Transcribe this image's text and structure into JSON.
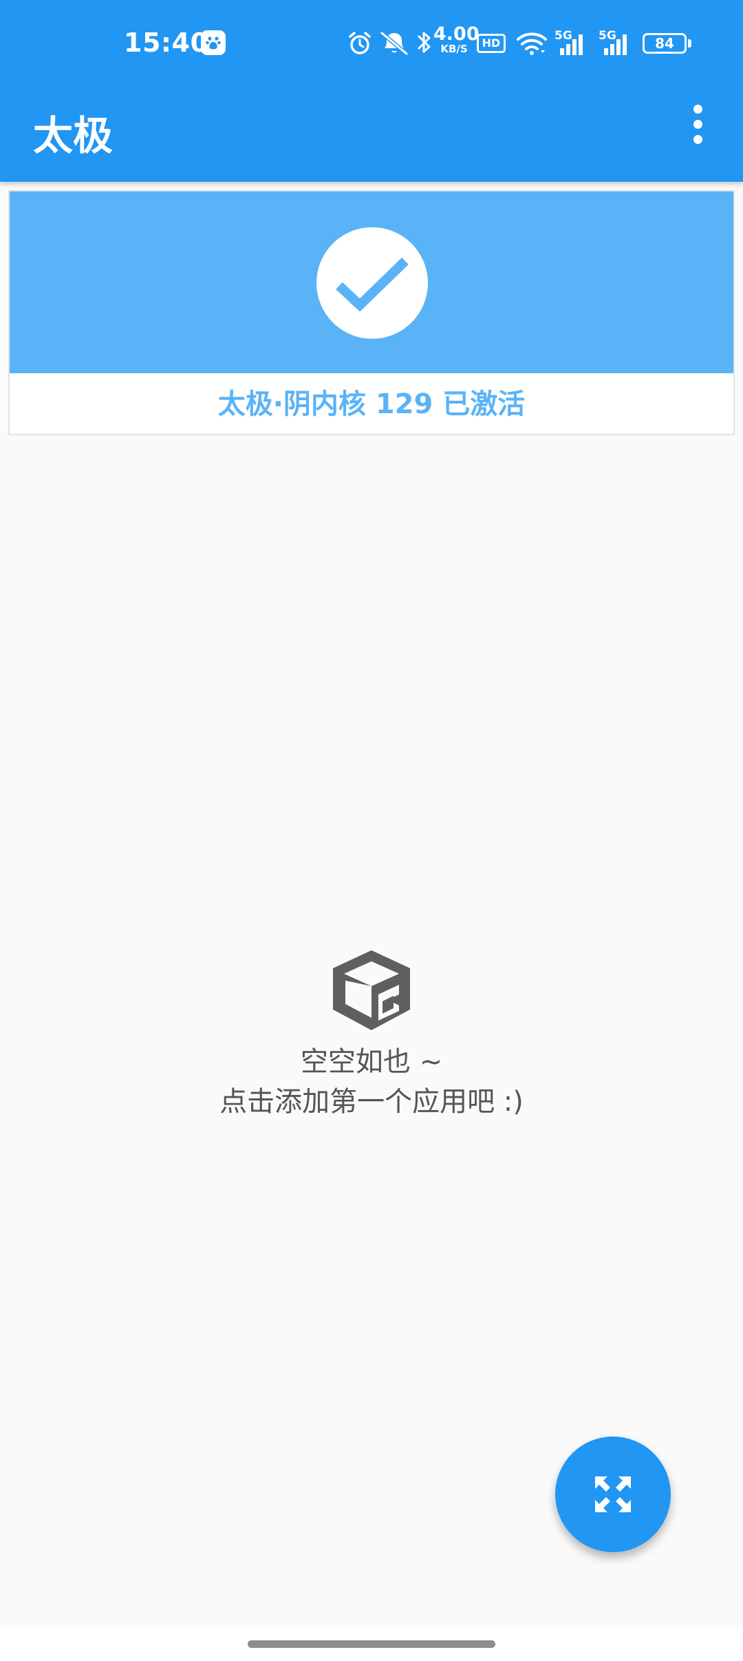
{
  "status_bar": {
    "time": "15:40",
    "net_speed_value": "4.00",
    "net_speed_unit": "KB/S",
    "hd_label": "HD",
    "sim1_label": "5G",
    "sim2_label": "5G",
    "battery_level": "84",
    "icons": [
      "baidu-icon",
      "alarm-icon",
      "mute-icon",
      "bluetooth-icon",
      "wifi-icon",
      "signal-icon",
      "battery-icon"
    ]
  },
  "app_bar": {
    "title": "太极",
    "menu_icon": "more-vert-icon"
  },
  "activation_card": {
    "status_text": "太极·阴内核 129 已激活",
    "icon": "check-icon"
  },
  "empty_state": {
    "icon": "box-icon",
    "title": "空空如也 ~",
    "hint": "点击添加第一个应用吧 :)"
  },
  "fab": {
    "icon": "expand-icon"
  },
  "colors": {
    "primary": "#2196f3",
    "banner": "#5ab3f7",
    "background": "#fafafa",
    "empty_text": "#555555"
  }
}
